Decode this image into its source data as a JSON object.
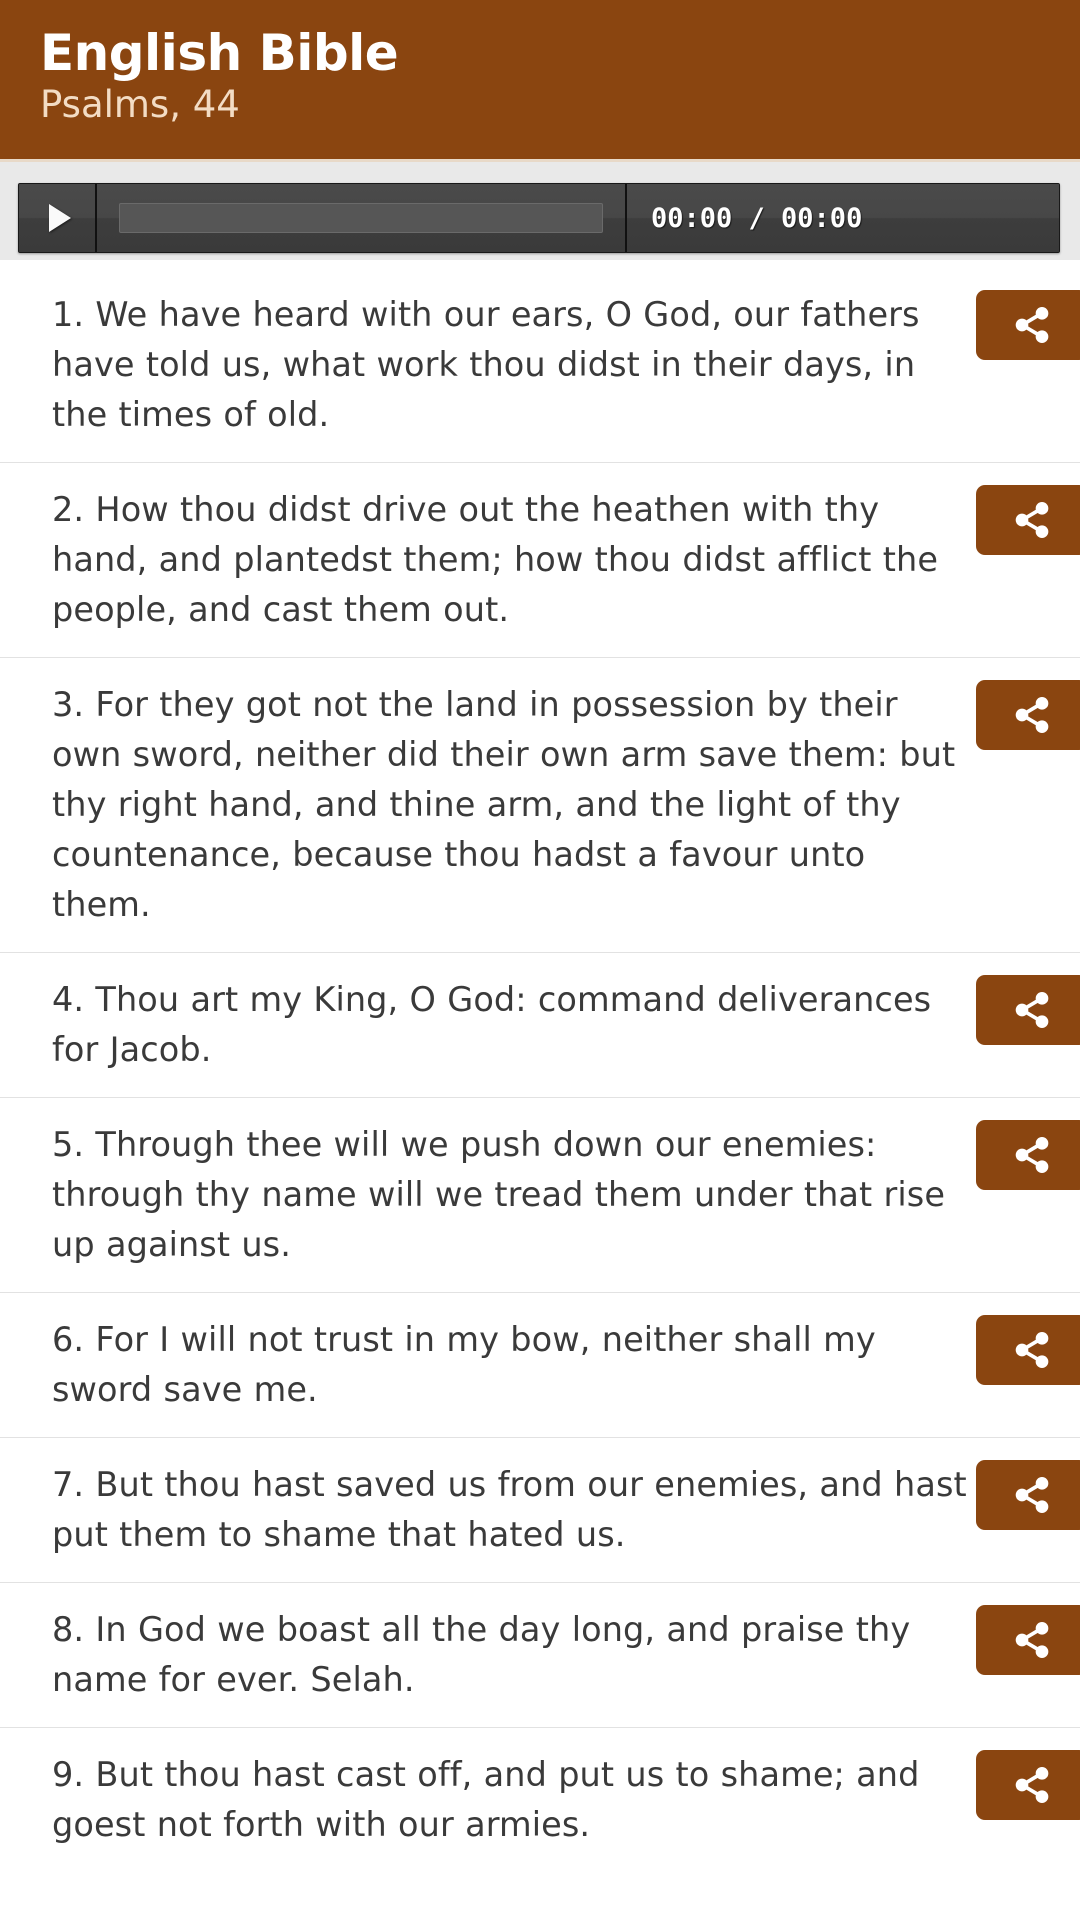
{
  "header": {
    "title": "English Bible",
    "subtitle": "Psalms, 44",
    "background_color": "#8a4510",
    "title_color": "#ffffff",
    "subtitle_color": "#f3dcc4"
  },
  "player": {
    "play_icon": "play-triangle-icon",
    "progress_value": 0,
    "time_display": "00:00 / 00:00",
    "current_time": "00:00",
    "duration": "00:00",
    "background_color": "#414141"
  },
  "share": {
    "icon": "share-icon",
    "label": "Share",
    "color": "#8a4510"
  },
  "verses": [
    {
      "number": "1",
      "text": "1. We have heard with our ears, O God, our fathers have told us, what work thou didst in their days, in the times of old."
    },
    {
      "number": "2",
      "text": "2. How thou didst drive out the heathen with thy hand, and plantedst them; how thou didst afflict the people, and cast them out."
    },
    {
      "number": "3",
      "text": "3. For they got not the land in possession by their own sword, neither did their own arm save them: but thy right hand, and thine arm, and the light of thy countenance, because thou hadst a favour unto them."
    },
    {
      "number": "4",
      "text": "4. Thou art my King, O God: command deliverances for Jacob."
    },
    {
      "number": "5",
      "text": "5. Through thee will we push down our enemies: through thy name will we tread them under that rise up against us."
    },
    {
      "number": "6",
      "text": "6. For I will not trust in my bow, neither shall my sword save me."
    },
    {
      "number": "7",
      "text": "7. But thou hast saved us from our enemies, and hast put them to shame that hated us."
    },
    {
      "number": "8",
      "text": "8. In God we boast all the day long, and praise thy name for ever. Selah."
    },
    {
      "number": "9",
      "text": "9. But thou hast cast off, and put us to shame; and goest not forth with our armies."
    }
  ]
}
